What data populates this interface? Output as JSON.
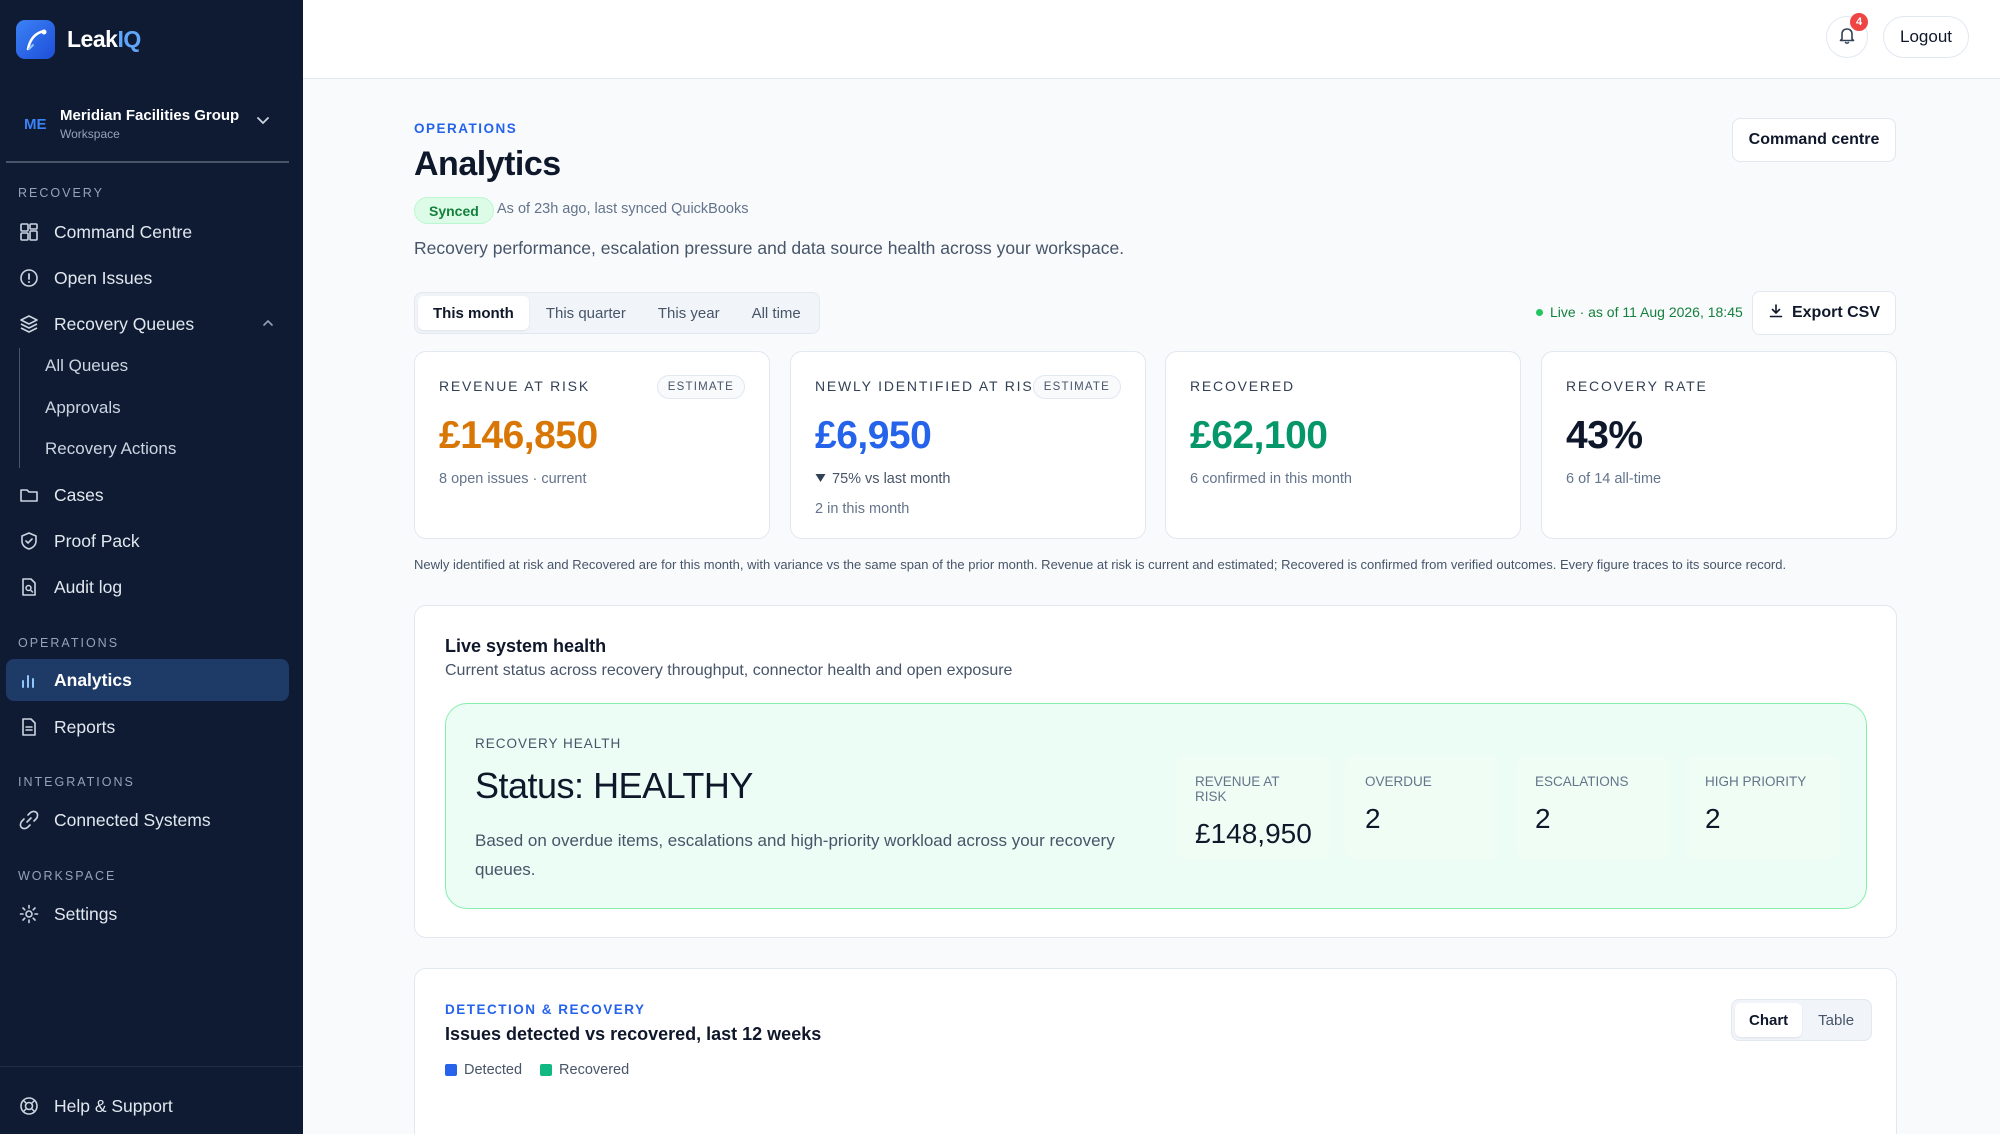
{
  "brand": {
    "name_part1": "Leak",
    "name_part2": "IQ"
  },
  "workspace": {
    "initials": "ME",
    "name": "Meridian Facilities Group",
    "type": "Workspace"
  },
  "sidebar": {
    "sections": {
      "recovery": "RECOVERY",
      "operations": "OPERATIONS",
      "integrations": "INTEGRATIONS",
      "workspace": "WORKSPACE"
    },
    "items": {
      "command_centre": "Command Centre",
      "open_issues": "Open Issues",
      "recovery_queues": "Recovery Queues",
      "all_queues": "All Queues",
      "approvals": "Approvals",
      "recovery_actions": "Recovery Actions",
      "cases": "Cases",
      "proof_pack": "Proof Pack",
      "audit_log": "Audit log",
      "analytics": "Analytics",
      "reports": "Reports",
      "connected_systems": "Connected Systems",
      "settings": "Settings",
      "help_support": "Help & Support"
    },
    "active_item": "analytics"
  },
  "topbar": {
    "notification_count": "4",
    "logout_label": "Logout"
  },
  "header": {
    "eyebrow": "OPERATIONS",
    "title": "Analytics",
    "synced_badge": "Synced",
    "sync_text": "As of 23h ago, last synced QuickBooks",
    "description": "Recovery performance, escalation pressure and data source health across your workspace.",
    "command_button": "Command centre"
  },
  "period_tabs": [
    "This month",
    "This quarter",
    "This year",
    "All time"
  ],
  "selected_period": "This month",
  "live_status": "Live · as of 11 Aug 2026, 18:45",
  "export_label": "Export CSV",
  "kpis": {
    "revenue_at_risk": {
      "label": "REVENUE AT RISK",
      "badge": "ESTIMATE",
      "value": "£146,850",
      "sub": "8 open issues · current",
      "color": "#d97706"
    },
    "newly_identified": {
      "label": "NEWLY IDENTIFIED AT RISK",
      "badge": "ESTIMATE",
      "value": "£6,950",
      "variance": "75% vs last month",
      "sub": "2 in this month",
      "color": "#2563eb"
    },
    "recovered": {
      "label": "RECOVERED",
      "value": "£62,100",
      "sub": "6 confirmed in this month",
      "color": "#059669"
    },
    "recovery_rate": {
      "label": "RECOVERY RATE",
      "value": "43%",
      "sub": "6 of 14 all-time",
      "color": "#0f172a"
    }
  },
  "kpi_note": "Newly identified at risk and Recovered are for this month, with variance vs the same span of the prior month. Revenue at risk is current and estimated; Recovered is confirmed from verified outcomes. Every figure traces to its source record.",
  "health": {
    "title": "Live system health",
    "subtitle": "Current status across recovery throughput, connector health and open exposure",
    "label": "RECOVERY HEALTH",
    "status": "Status: HEALTHY",
    "description": "Based on overdue items, escalations and high-priority workload across your recovery queues.",
    "metrics": [
      {
        "label": "REVENUE AT RISK",
        "value": "£148,950"
      },
      {
        "label": "OVERDUE",
        "value": "2"
      },
      {
        "label": "ESCALATIONS",
        "value": "2"
      },
      {
        "label": "HIGH PRIORITY",
        "value": "2"
      }
    ]
  },
  "detection": {
    "eyebrow": "DETECTION & RECOVERY",
    "title": "Issues detected vs recovered, last 12 weeks",
    "legend": [
      {
        "name": "Detected",
        "color": "#2563eb"
      },
      {
        "name": "Recovered",
        "color": "#10b981"
      }
    ],
    "view_tabs": [
      "Chart",
      "Table"
    ],
    "selected_view": "Chart"
  }
}
